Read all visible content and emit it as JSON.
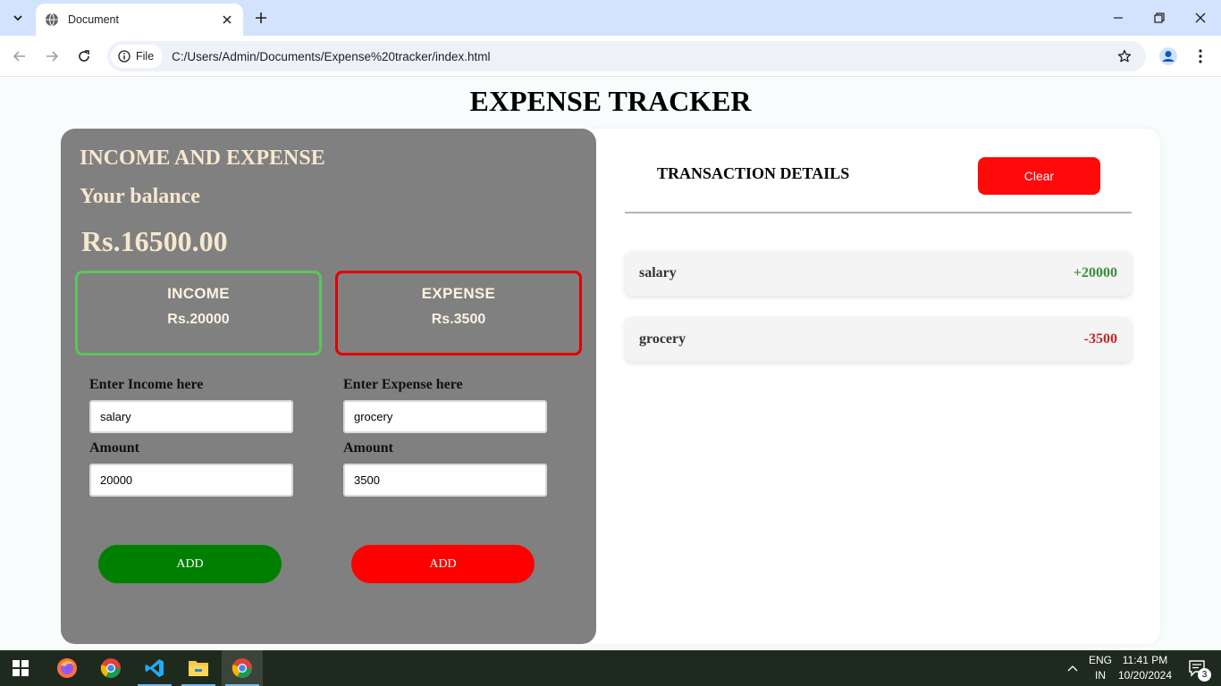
{
  "browser": {
    "tab_title": "Document",
    "site_chip": "File",
    "url": "C:/Users/Admin/Documents/Expense%20tracker/index.html"
  },
  "page": {
    "title": "EXPENSE TRACKER",
    "left": {
      "heading": "INCOME AND EXPENSE",
      "balance_label": "Your balance",
      "balance": "Rs.16500.00",
      "income_box": {
        "title": "INCOME",
        "amount": "Rs.20000"
      },
      "expense_box": {
        "title": "EXPENSE",
        "amount": "Rs.3500"
      },
      "income_form": {
        "name_label": "Enter Income here",
        "name_value": "salary",
        "amount_label": "Amount",
        "amount_value": "20000",
        "button": "ADD"
      },
      "expense_form": {
        "name_label": "Enter Expense here",
        "name_value": "grocery",
        "amount_label": "Amount",
        "amount_value": "3500",
        "button": "ADD"
      }
    },
    "right": {
      "heading": "TRANSACTION DETAILS",
      "clear_button": "Clear",
      "transactions": [
        {
          "name": "salary",
          "amount": "+20000",
          "type": "income"
        },
        {
          "name": "grocery",
          "amount": "-3500",
          "type": "expense"
        }
      ]
    }
  },
  "taskbar": {
    "apps": [
      "start-icon",
      "firefox-icon",
      "chrome-icon",
      "vscode-icon",
      "file-explorer-icon",
      "chrome-icon"
    ],
    "language": "ENG",
    "region": "IN",
    "time": "11:41 PM",
    "date": "10/20/2024",
    "notification_count": "3"
  },
  "colors": {
    "panel_gray": "#808080",
    "cream_text": "#f7e7cf",
    "income_green": "#008000",
    "expense_red": "#ff0000",
    "income_border": "#5cc45c",
    "expense_border": "#e00000"
  }
}
